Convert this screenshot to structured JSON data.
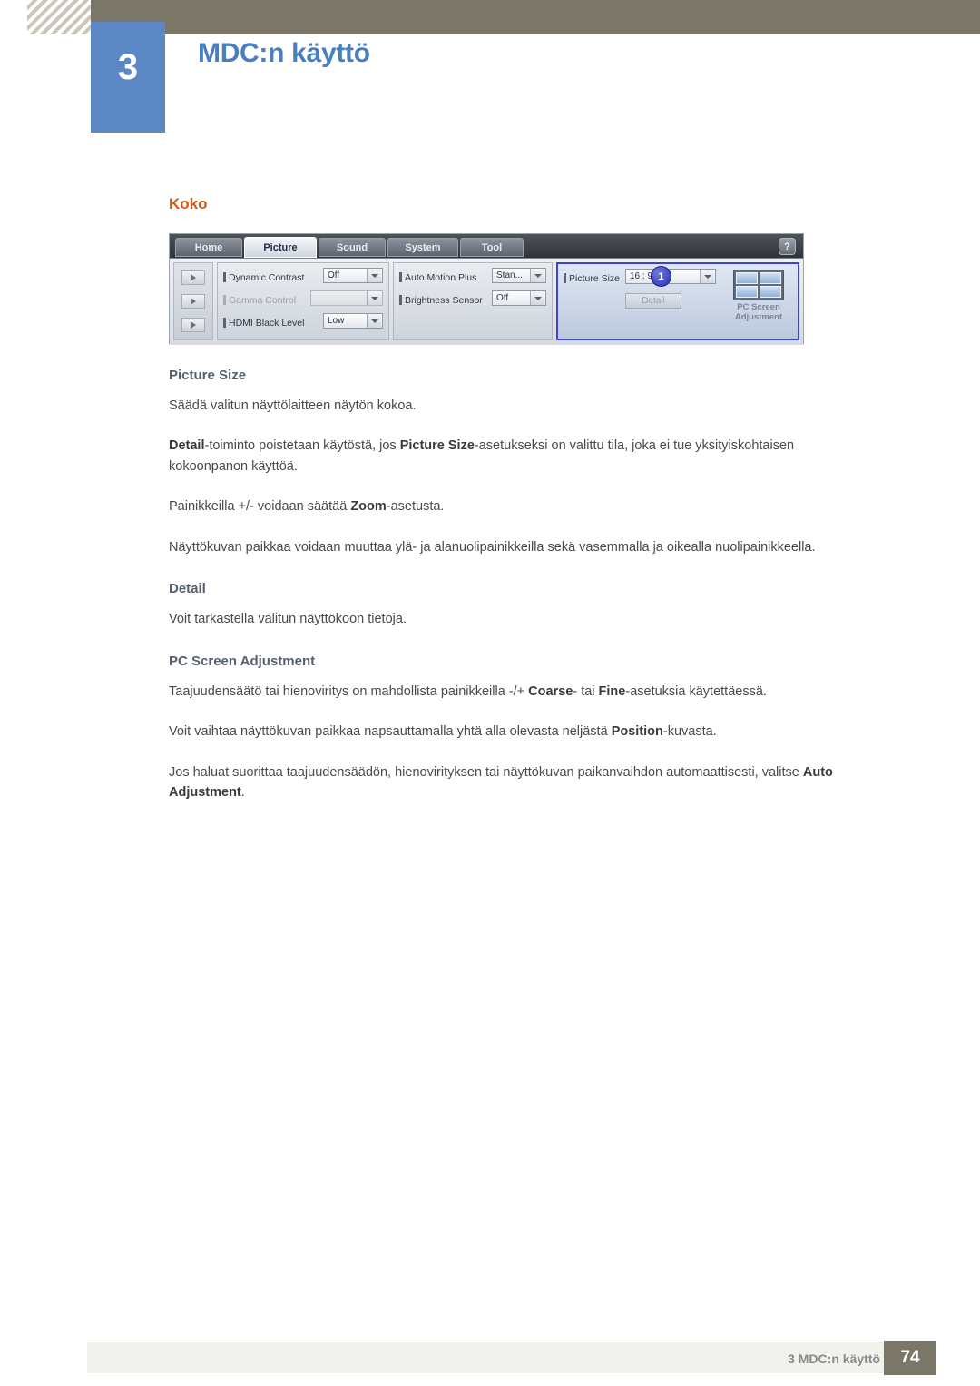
{
  "header": {
    "chapter_number": "3",
    "chapter_title": "MDC:n käyttö"
  },
  "content": {
    "section_title": "Koko",
    "headings": {
      "picture_size": "Picture Size",
      "detail": "Detail",
      "pc_screen_adjustment": "PC Screen Adjustment"
    },
    "paragraphs": {
      "p1": "Säädä valitun näyttölaitteen näytön kokoa.",
      "p2_a": "Detail",
      "p2_b": "-toiminto poistetaan käytöstä, jos ",
      "p2_c": "Picture Size",
      "p2_d": "-asetukseksi on valittu tila, joka ei tue yksityiskohtaisen kokoonpanon käyttöä.",
      "p3_a": "Painikkeilla +/- voidaan säätää ",
      "p3_b": "Zoom",
      "p3_c": "-asetusta.",
      "p4": "Näyttökuvan paikkaa voidaan muuttaa ylä- ja alanuolipainikkeilla sekä vasemmalla ja oikealla nuolipainikkeella.",
      "p5": "Voit tarkastella valitun näyttökoon tietoja.",
      "p6_a": "Taajuudensäätö tai hienoviritys on mahdollista painikkeilla -/+ ",
      "p6_b": "Coarse",
      "p6_c": "- tai ",
      "p6_d": "Fine",
      "p6_e": "-asetuksia käytettäessä.",
      "p7_a": "Voit vaihtaa näyttökuvan paikkaa napsauttamalla yhtä alla olevasta neljästä ",
      "p7_b": "Position",
      "p7_c": "-kuvasta.",
      "p8_a": "Jos haluat suorittaa taajuudensäädön, hienovirityksen tai näyttökuvan paikanvaihdon automaattisesti, valitse ",
      "p8_b": "Auto Adjustment",
      "p8_c": "."
    }
  },
  "mdc": {
    "tabs": [
      {
        "label": "Home",
        "active": false
      },
      {
        "label": "Picture",
        "active": true
      },
      {
        "label": "Sound",
        "active": false
      },
      {
        "label": "System",
        "active": false
      },
      {
        "label": "Tool",
        "active": false
      }
    ],
    "help_label": "?",
    "group1": [
      {
        "label": "Dynamic Contrast",
        "value": "Off",
        "disabled": false
      },
      {
        "label": "Gamma Control",
        "value": "",
        "disabled": true
      },
      {
        "label": "HDMI Black Level",
        "value": "Low",
        "disabled": false
      }
    ],
    "group2": [
      {
        "label": "Auto Motion Plus",
        "value": "Stan...",
        "disabled": false
      },
      {
        "label": "Brightness Sensor",
        "value": "Off",
        "disabled": false
      }
    ],
    "group3": {
      "label": "Picture Size",
      "value": "16 : 9",
      "detail_button": "Detail",
      "pc_screen_label_line1": "PC Screen",
      "pc_screen_label_line2": "Adjustment"
    },
    "callout": "1"
  },
  "footer": {
    "text": "3 MDC:n käyttö",
    "page": "74"
  }
}
